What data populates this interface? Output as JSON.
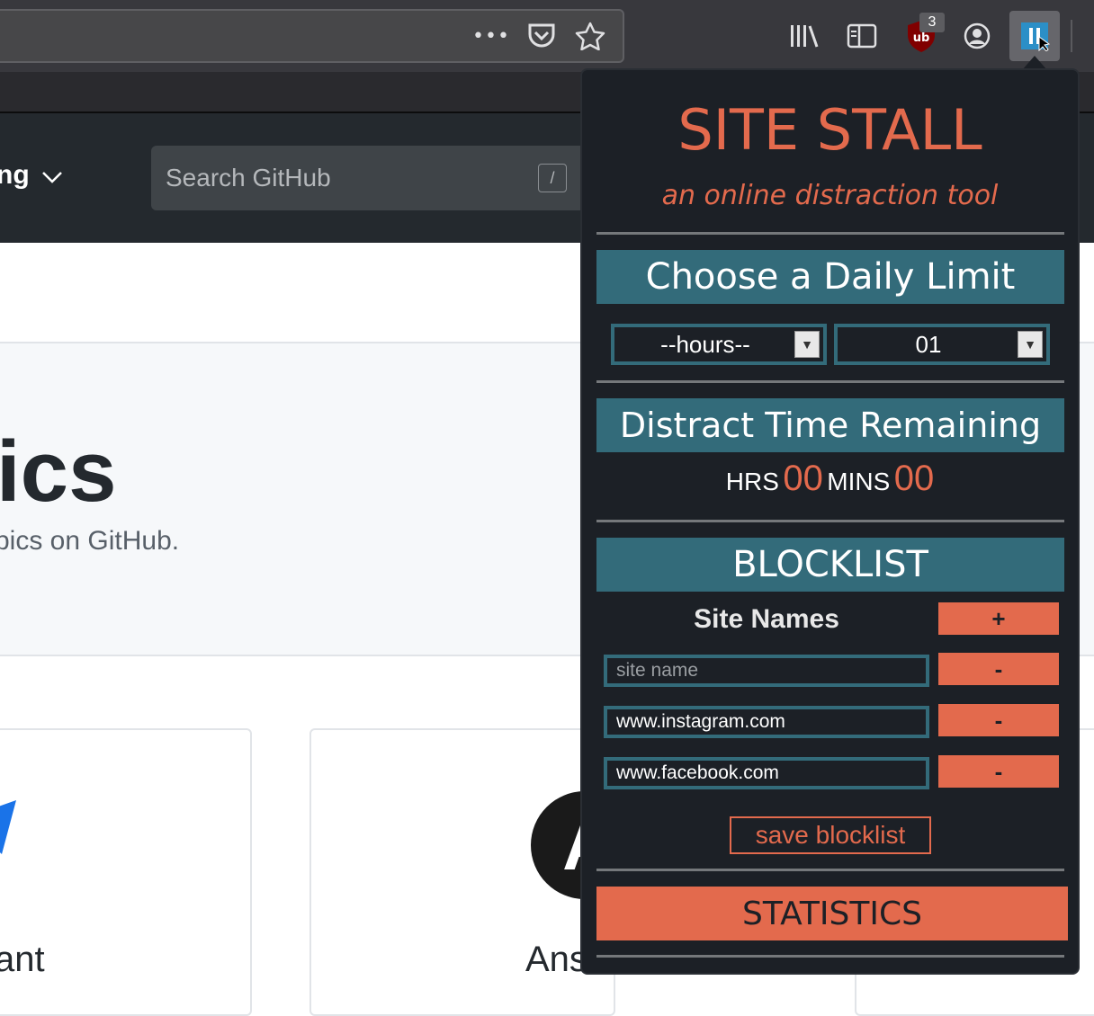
{
  "browser": {
    "more_icon": "•••",
    "ublock_count": "3"
  },
  "github": {
    "nav_label": "ng",
    "search_placeholder": "Search GitHub",
    "search_shortcut": "/",
    "topics_title": "ics",
    "topics_subtitle": "pics on GitHub.",
    "card1_name": "ant",
    "card2_name": "Ans"
  },
  "popup": {
    "title": "SITE STALL",
    "subtitle": "an online distraction tool",
    "daily_limit_heading": "Choose a Daily Limit",
    "hours_select": "--hours--",
    "minutes_select": "01",
    "remaining_heading": "Distract Time Remaining",
    "hrs_label": "HRS",
    "hrs_value": "00",
    "mins_label": "MINS",
    "mins_value": "00",
    "blocklist_heading": "BLOCKLIST",
    "site_names_label": "Site Names",
    "add_label": "+",
    "remove_label": "-",
    "site_placeholder": "site name",
    "sites": [
      "www.instagram.com",
      "www.facebook.com"
    ],
    "save_label": "save blocklist",
    "statistics_label": "STATISTICS"
  },
  "colors": {
    "accent_orange": "#e36a4d",
    "teal": "#336b7a",
    "popup_bg": "#1c2026"
  }
}
